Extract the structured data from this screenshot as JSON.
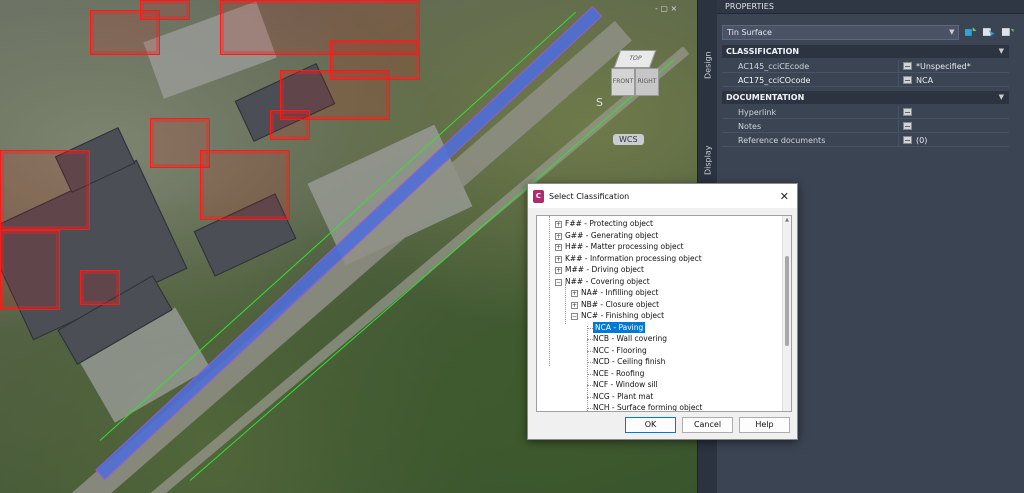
{
  "viewport": {
    "viewcube": {
      "top": "TOP",
      "front": "FRONT",
      "right": "RIGHT"
    },
    "compass_s": "S",
    "wcs_label": "WCS",
    "controls": "-  ▢  ×"
  },
  "side_tabs": {
    "design": "Design",
    "display": "Display"
  },
  "properties": {
    "header": "PROPERTIES",
    "object_type": "Tin Surface",
    "sections": {
      "classification": "CLASSIFICATION",
      "documentation": "DOCUMENTATION"
    },
    "classification_rows": [
      {
        "name": "AC145_cciCEcode",
        "value": "*Unspecified*"
      },
      {
        "name": "AC175_cciCOcode",
        "value": "NCA"
      }
    ],
    "documentation_rows": [
      {
        "name": "Hyperlink",
        "value": ""
      },
      {
        "name": "Notes",
        "value": ""
      },
      {
        "name": "Reference documents",
        "value": "(0)"
      }
    ]
  },
  "dialog": {
    "title": "Select Classification",
    "logo_letter": "C",
    "tree": [
      {
        "label": "F## - Protecting object",
        "level": 1,
        "expander": "+"
      },
      {
        "label": "G## - Generating object",
        "level": 1,
        "expander": "+"
      },
      {
        "label": "H## - Matter processing object",
        "level": 1,
        "expander": "+"
      },
      {
        "label": "K## - Information processing object",
        "level": 1,
        "expander": "+"
      },
      {
        "label": "M## - Driving object",
        "level": 1,
        "expander": "+"
      },
      {
        "label": "N## - Covering object",
        "level": 1,
        "expander": "−"
      },
      {
        "label": "NA# - Infilling object",
        "level": 2,
        "expander": "+"
      },
      {
        "label": "NB# - Closure object",
        "level": 2,
        "expander": "+"
      },
      {
        "label": "NC# - Finishing object",
        "level": 2,
        "expander": "−"
      },
      {
        "label": "NCA - Paving",
        "level": 3,
        "expander": "",
        "selected": true
      },
      {
        "label": "NCB - Wall covering",
        "level": 3,
        "expander": ""
      },
      {
        "label": "NCC - Flooring",
        "level": 3,
        "expander": ""
      },
      {
        "label": "NCD - Ceiling finish",
        "level": 3,
        "expander": ""
      },
      {
        "label": "NCE - Roofing",
        "level": 3,
        "expander": ""
      },
      {
        "label": "NCF - Window sill",
        "level": 3,
        "expander": ""
      },
      {
        "label": "NCG - Plant mat",
        "level": 3,
        "expander": ""
      },
      {
        "label": "NCH - Surface forming object",
        "level": 3,
        "expander": ""
      }
    ],
    "buttons": {
      "ok": "OK",
      "cancel": "Cancel",
      "help": "Help"
    }
  },
  "colors": {
    "accent": "#0078d7",
    "surface_blue": "#4f6fd8",
    "building_red": "#ff1a1a",
    "panel_bg": "#3b4453"
  }
}
